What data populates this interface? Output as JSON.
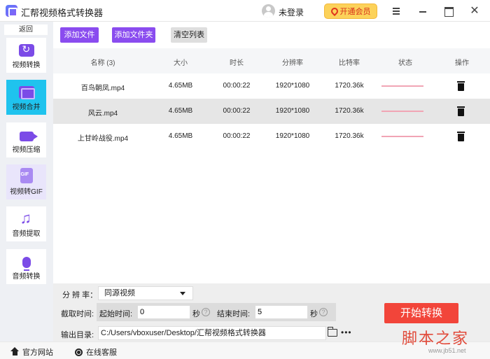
{
  "app": {
    "title": "汇帮视频格式转换器",
    "login_label": "未登录",
    "vip_label": "开通会员",
    "close_glyph": "✕"
  },
  "sidebar": {
    "back_label": "返回",
    "items": [
      {
        "label": "视频转换",
        "icon": "video-convert-icon"
      },
      {
        "label": "视频合并",
        "icon": "video-merge-icon",
        "active": true
      },
      {
        "label": "视频压缩",
        "icon": "video-compress-icon"
      },
      {
        "label": "视频转GIF",
        "icon": "gif-icon"
      },
      {
        "label": "音频提取",
        "icon": "music-note-icon"
      },
      {
        "label": "音频转换",
        "icon": "microphone-icon"
      }
    ]
  },
  "toolbar": {
    "add_file": "添加文件",
    "add_folder": "添加文件夹",
    "clear_list": "清空列表"
  },
  "table": {
    "headers": {
      "name": "名称 (3)",
      "size": "大小",
      "duration": "时长",
      "resolution": "分辨率",
      "bitrate": "比特率",
      "status": "状态",
      "action": "操作"
    },
    "rows": [
      {
        "name": "百鸟朝凤.mp4",
        "size": "4.65MB",
        "duration": "00:00:22",
        "resolution": "1920*1080",
        "bitrate": "1720.36k"
      },
      {
        "name": "风云.mp4",
        "size": "4.65MB",
        "duration": "00:00:22",
        "resolution": "1920*1080",
        "bitrate": "1720.36k"
      },
      {
        "name": "上甘岭战役.mp4",
        "size": "4.65MB",
        "duration": "00:00:22",
        "resolution": "1920*1080",
        "bitrate": "1720.36k"
      }
    ]
  },
  "settings": {
    "resolution_label": "分 辨 率：",
    "resolution_value": "同源视频",
    "clip_label": "截取时间:",
    "start_label": "起始时间:",
    "start_value": "0",
    "end_label": "结束时间:",
    "end_value": "5",
    "unit": "秒",
    "help_glyph": "?",
    "output_label": "输出目录:",
    "output_path": "C:/Users/vboxuser/Desktop/汇帮视频格式转换器",
    "more_glyph": "•••",
    "start_button": "开始转换"
  },
  "footer": {
    "website": "官方网站",
    "service": "在线客服"
  },
  "watermark": {
    "main": "脚本之家",
    "sub": "www.jb51.net"
  },
  "colors": {
    "accent_purple": "#8a4cef",
    "active_tab": "#1fc3ee",
    "start_red": "#f2453a",
    "vip_gold": "#fcd25a"
  }
}
